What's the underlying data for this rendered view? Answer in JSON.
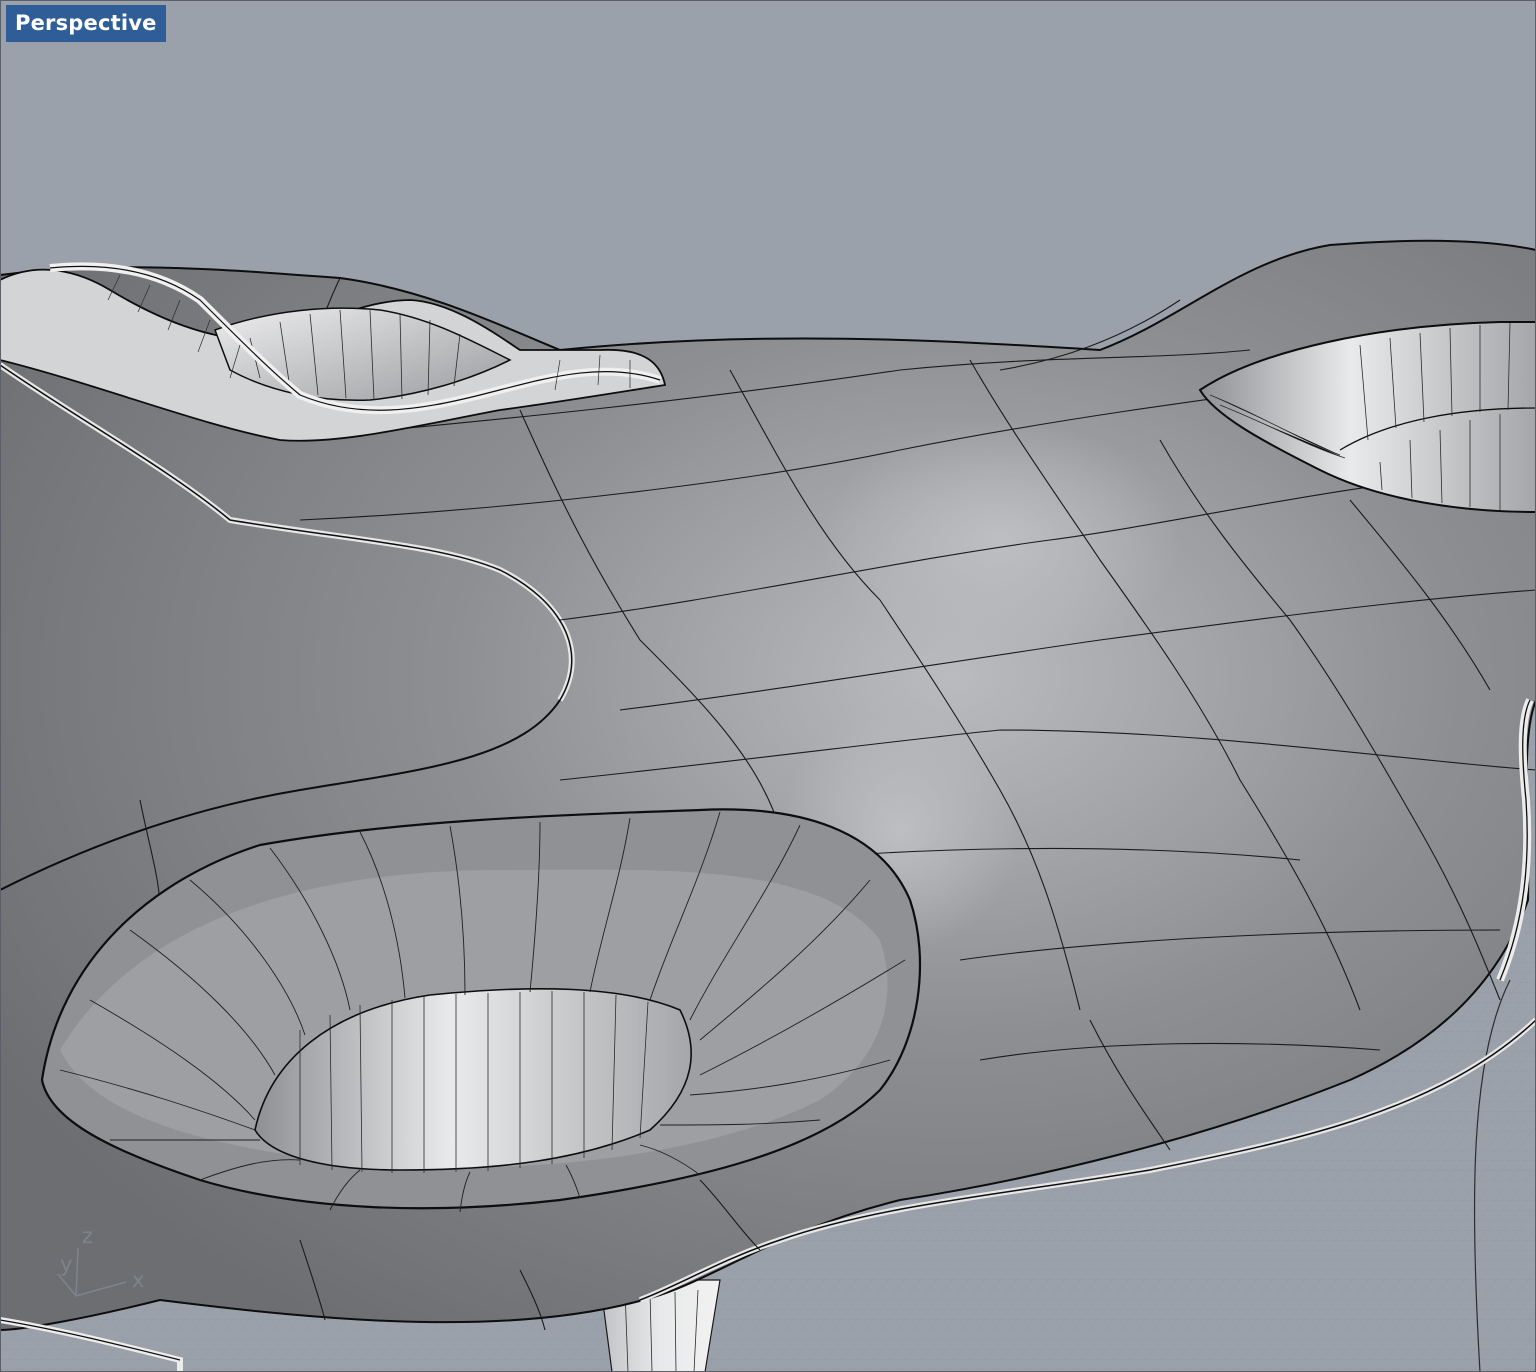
{
  "viewport": {
    "title": "Perspective",
    "background_color": "#9ba1aa",
    "title_tab_color": "#2f5d98",
    "grid_color": "#8f96a0",
    "surface_color": "#8a8c8f",
    "edge_color": "#101010"
  },
  "axis_widget": {
    "x_label": "x",
    "y_label": "y",
    "z_label": "z"
  }
}
